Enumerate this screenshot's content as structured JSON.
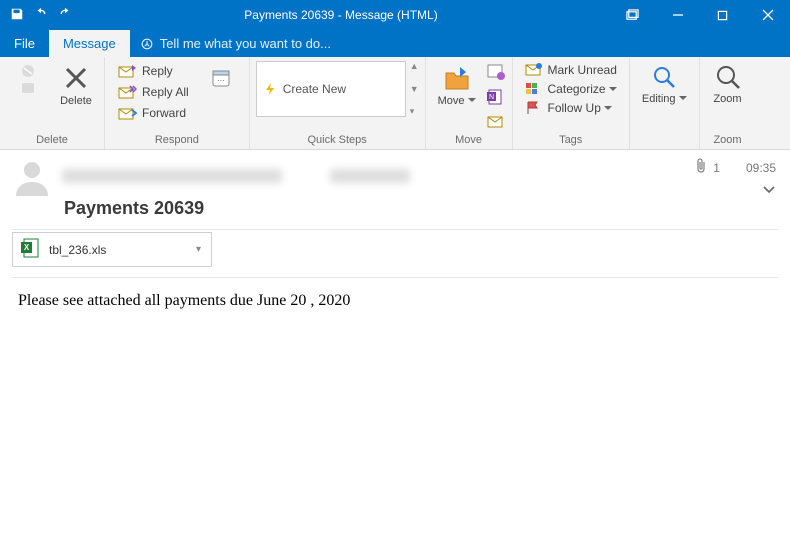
{
  "window": {
    "title": "Payments 20639 - Message (HTML)"
  },
  "menutabs": {
    "file": "File",
    "message": "Message",
    "tellme": "Tell me what you want to do..."
  },
  "ribbon": {
    "delete": {
      "label": "Delete",
      "group": "Delete"
    },
    "respond": {
      "reply": "Reply",
      "replyall": "Reply All",
      "forward": "Forward",
      "group": "Respond"
    },
    "quicksteps": {
      "create": "Create New",
      "group": "Quick Steps"
    },
    "move": {
      "btn": "Move",
      "group": "Move"
    },
    "tags": {
      "unread": "Mark Unread",
      "categorize": "Categorize",
      "followup": "Follow Up",
      "group": "Tags"
    },
    "editing": {
      "label": "Editing"
    },
    "zoom": {
      "label": "Zoom",
      "group": "Zoom"
    }
  },
  "header": {
    "subject": "Payments 20639",
    "attach_count": "1",
    "time": "09:35"
  },
  "attachment": {
    "name": "tbl_236.xls"
  },
  "body": {
    "text": "Please see attached all payments due June 20 , 2020"
  }
}
